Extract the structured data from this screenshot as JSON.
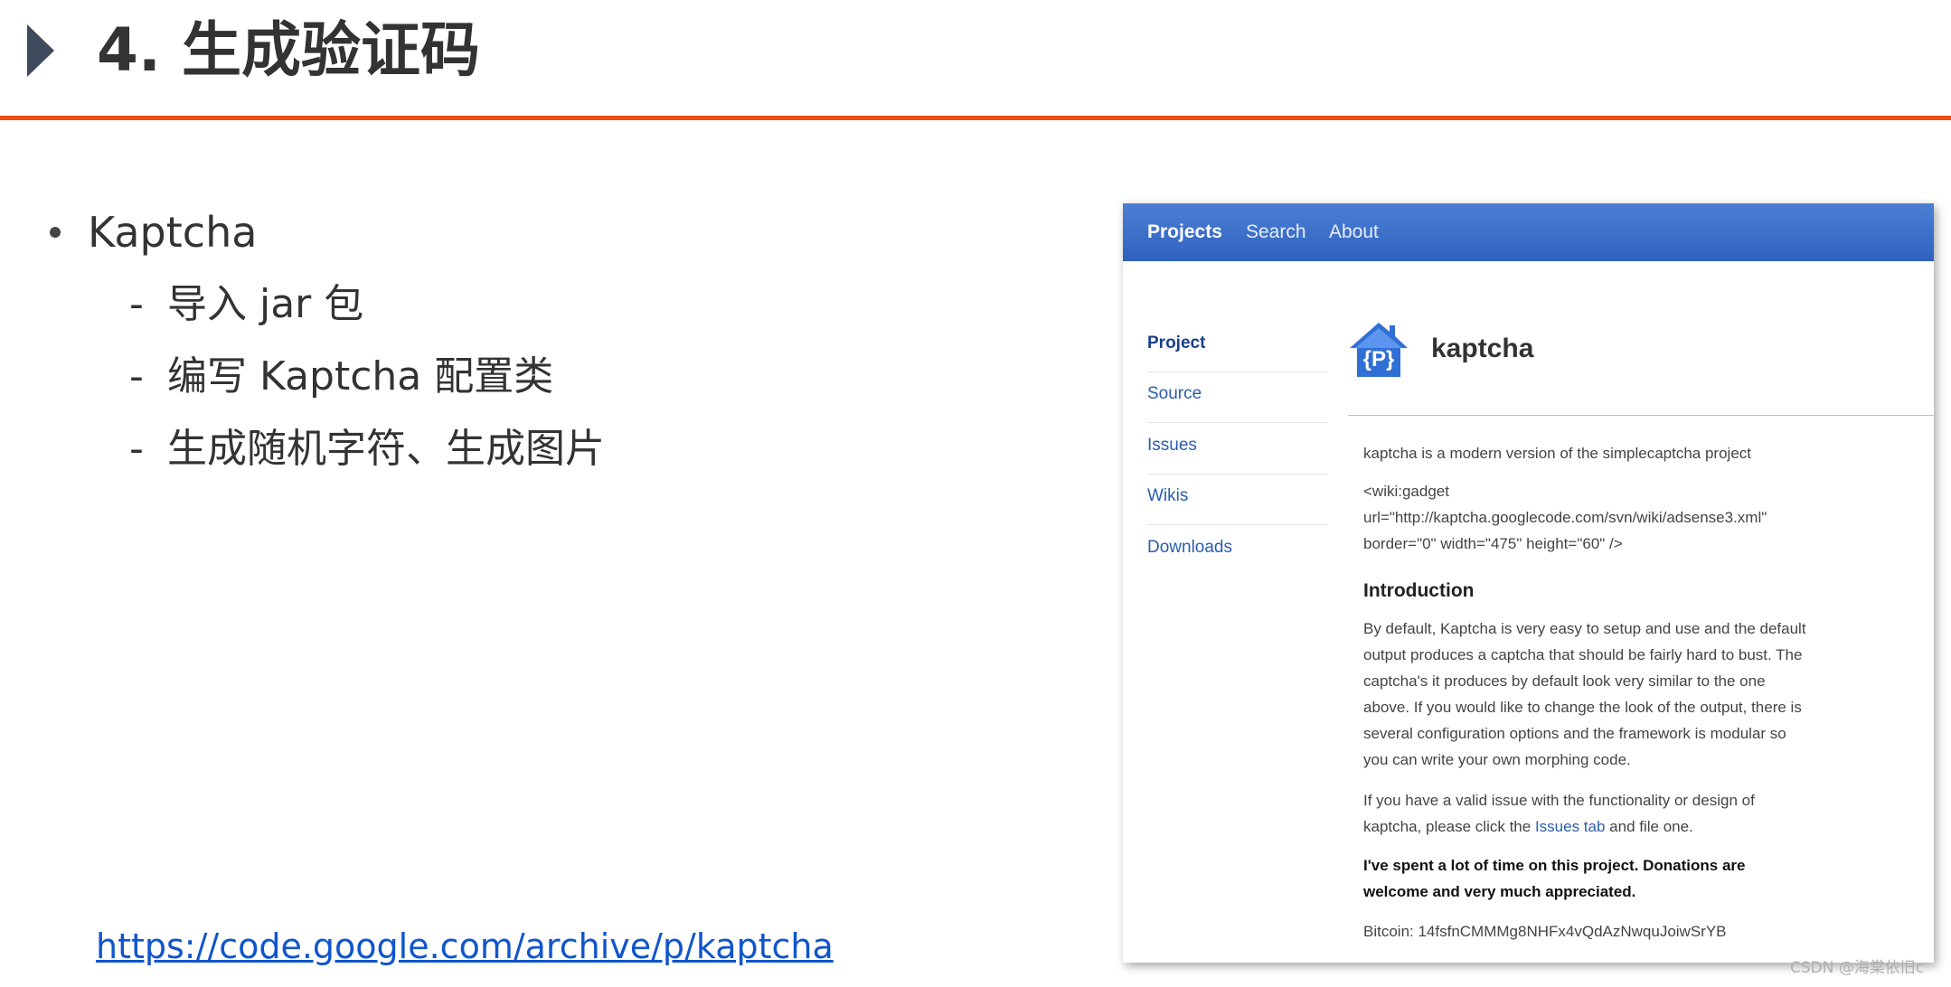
{
  "slide": {
    "title": "4. 生成验证码",
    "bullet": "Kaptcha",
    "sub_items": [
      "导入 jar 包",
      "编写 Kaptcha 配置类",
      "生成随机字符、生成图片"
    ],
    "sub_dash": "-",
    "link": "https://code.google.com/archive/p/kaptcha"
  },
  "screenshot": {
    "nav": [
      "Projects",
      "Search",
      "About"
    ],
    "sidebar": [
      "Project",
      "Source",
      "Issues",
      "Wikis",
      "Downloads"
    ],
    "logo_text": "{P}",
    "project_name": "kaptcha",
    "summary": "kaptcha is a modern version of the simplecaptcha project",
    "gadget_lines": [
      "<wiki:gadget",
      "url=\"http://kaptcha.googlecode.com/svn/wiki/adsense3.xml\"",
      "border=\"0\" width=\"475\" height=\"60\" />"
    ],
    "intro_heading": "Introduction",
    "intro_lines": [
      "By default, Kaptcha is very easy to setup and use and the default",
      "output produces a captcha that should be fairly hard to bust. The",
      "captcha's it produces by default look very similar to the one",
      "above. If you would like to change the look of the output, there is",
      "several configuration options and the framework is modular so",
      "you can write your own morphing code."
    ],
    "issue_line1": "If you have a valid issue with the functionality or design of",
    "issue_line2_pre": "kaptcha, please click the ",
    "issue_link": "Issues tab",
    "issue_line2_post": " and file one.",
    "donate_lines": [
      "I've spent a lot of time on this project. Donations are",
      "welcome and very much appreciated."
    ],
    "bitcoin": "Bitcoin: 14fsfnCMMMg8NHFx4vQdAzNwquJoiwSrYB"
  },
  "watermark": "CSDN @海棠依旧c",
  "colors": {
    "accent_rule": "#ef4e12",
    "navbar": "#3a6cc8",
    "link": "#1155cc",
    "title_arrow": "#3f4a5c"
  }
}
